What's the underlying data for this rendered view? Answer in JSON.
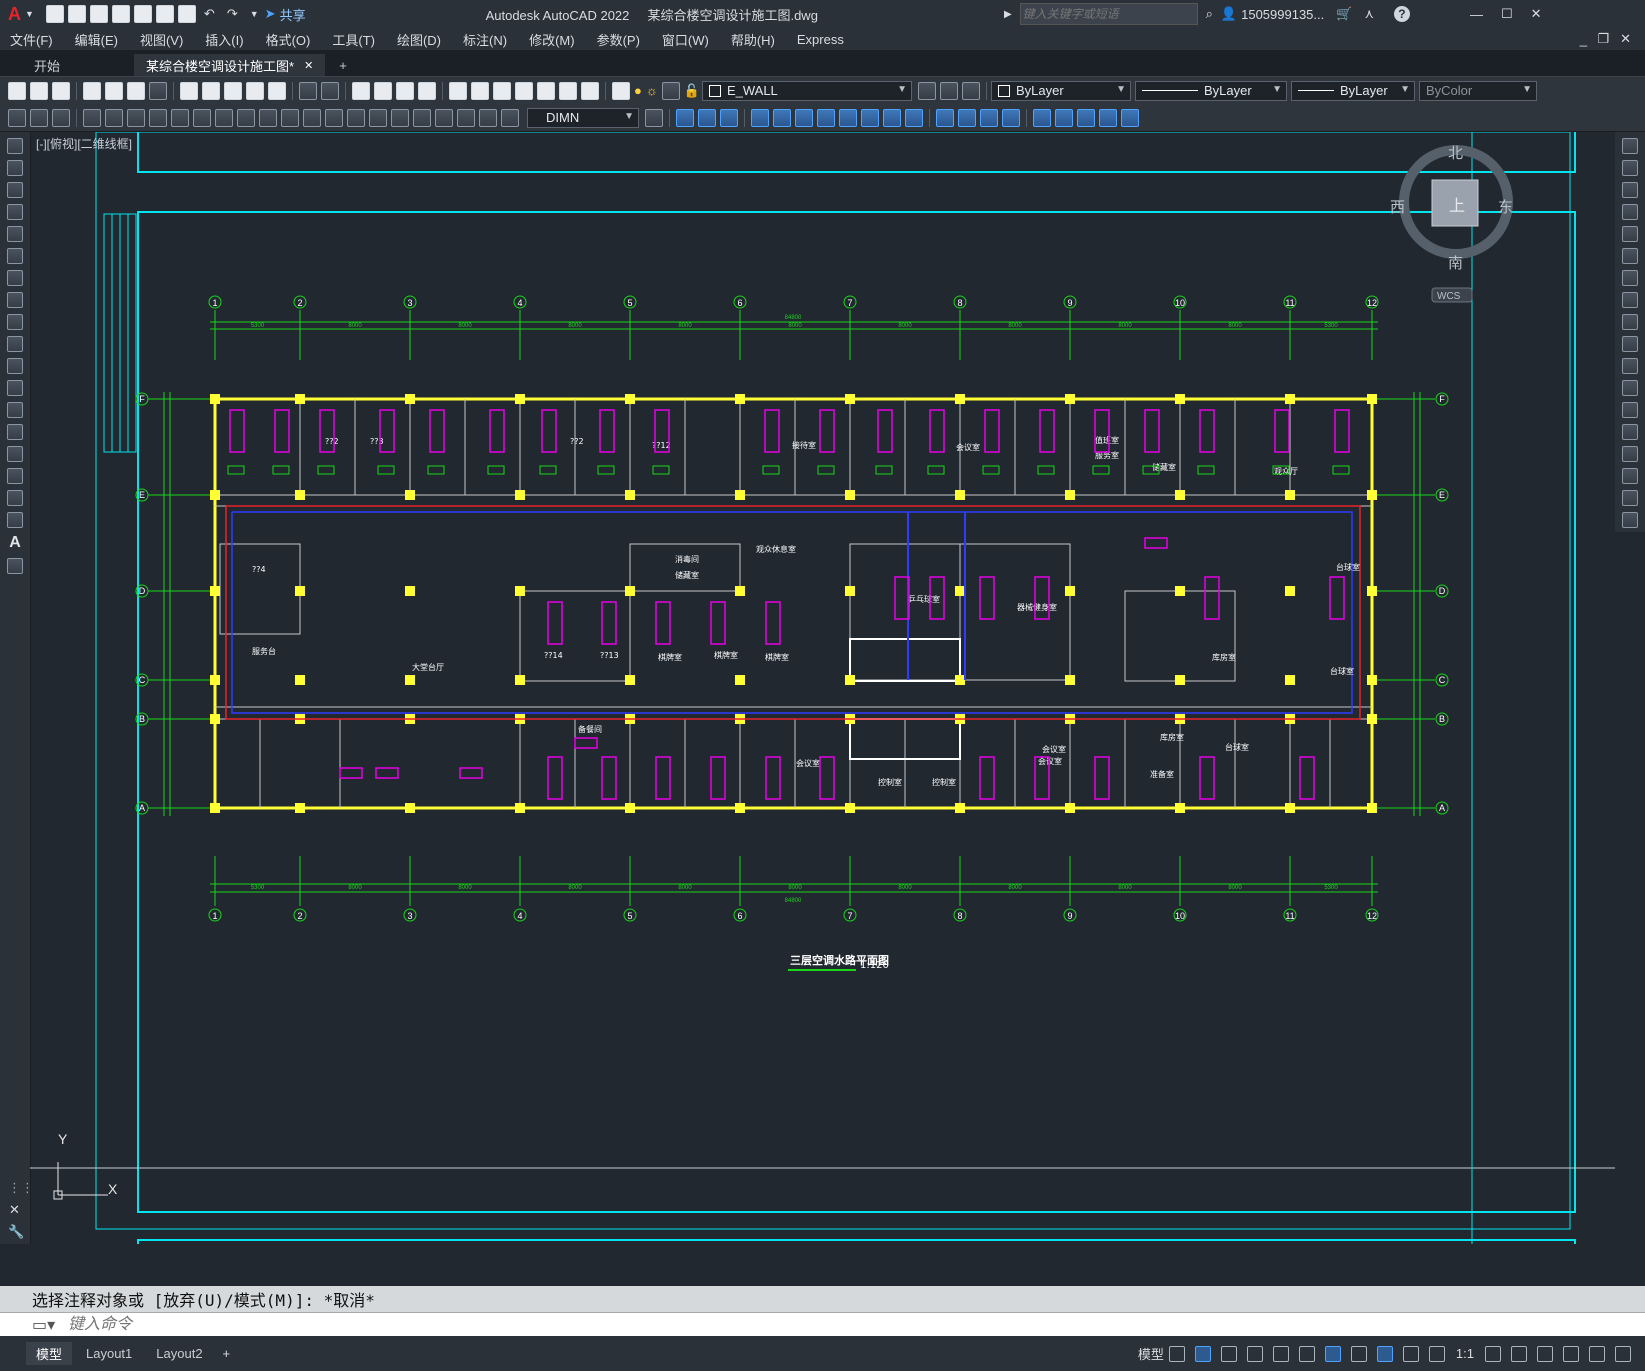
{
  "window": {
    "app_title": "Autodesk AutoCAD 2022",
    "file_title": "某综合楼空调设计施工图.dwg",
    "search_placeholder": "键入关键字或短语",
    "user": "1505999135...",
    "share_label": "共享"
  },
  "menu": [
    "文件(F)",
    "编辑(E)",
    "视图(V)",
    "插入(I)",
    "格式(O)",
    "工具(T)",
    "绘图(D)",
    "标注(N)",
    "修改(M)",
    "参数(P)",
    "窗口(W)",
    "帮助(H)",
    "Express"
  ],
  "tabs": {
    "start": "开始",
    "drawing": "某综合楼空调设计施工图*",
    "close": "✕",
    "add": "+"
  },
  "toolbar": {
    "layer": "E_WALL",
    "color": "ByLayer",
    "linetype": "ByLayer",
    "lineweight": "ByLayer",
    "plotstyle": "ByColor",
    "dimstyle": "DIMN"
  },
  "viewport": {
    "label": "[-][俯视][二维线框]",
    "viewcube": {
      "north": "北",
      "south": "南",
      "east": "东",
      "west": "西",
      "top": "上",
      "wcs": "WCS"
    }
  },
  "drawing": {
    "colors": {
      "background": "#212830",
      "frame": "#00e5ee",
      "grid": "#19d619",
      "wall": "#ffff33",
      "duct_red": "#e8232a",
      "duct_blue": "#2f3cff",
      "unit": "#e600e6",
      "gray": "#c8c8c8"
    },
    "grid_numbers": [
      "1",
      "2",
      "3",
      "4",
      "5",
      "6",
      "7",
      "8",
      "9",
      "10",
      "11",
      "12"
    ],
    "grid_letters": [
      "F",
      "E",
      "D",
      "C",
      "B",
      "A"
    ],
    "top_spans": [
      "5300",
      "8000",
      "8000",
      "8000",
      "8000",
      "8000",
      "8000",
      "8000",
      "8000",
      "8000",
      "5300"
    ],
    "total_length": "84800",
    "room_labels": [
      "??2",
      "??3",
      "??2",
      "??12",
      "接待室",
      "会议室",
      "值班室",
      "服务室",
      "储藏室",
      "观众厅",
      "??4",
      "服务台",
      "大堂台厅",
      "消毒间",
      "储藏室",
      "观众休息室",
      "乒乓球室",
      "器械健身室",
      "??14",
      "??13",
      "棋牌室",
      "棋牌室",
      "棋牌室",
      "台球室",
      "台球室",
      "库房室",
      "会议室",
      "会议室",
      "台球室",
      "会议室",
      "控制室",
      "控制室",
      "准备室",
      "库房室",
      "备餐间"
    ],
    "caption": "三层空调水路平面图",
    "scale": "1:120"
  },
  "command": {
    "history": "选择注释对象或 [放弃(U)/模式(M)]: *取消*",
    "placeholder": "键入命令"
  },
  "status": {
    "layout_tabs": [
      "模型",
      "Layout1",
      "Layout2"
    ],
    "model_label": "模型",
    "scale": "1:1"
  }
}
